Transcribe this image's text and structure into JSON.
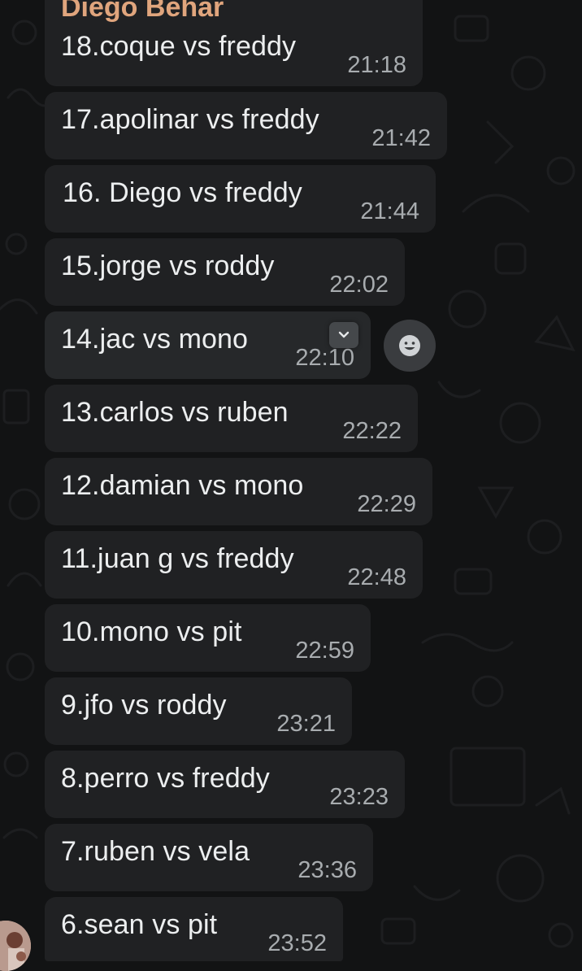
{
  "chat": {
    "sender_name": "Diego Behar",
    "messages": [
      {
        "text": "18.coque vs freddy",
        "time": "21:18"
      },
      {
        "text": "17.apolinar vs freddy",
        "time": "21:42"
      },
      {
        "text": "16. Diego vs freddy",
        "time": "21:44"
      },
      {
        "text": "15.jorge vs roddy",
        "time": "22:02"
      },
      {
        "text": "14.jac vs mono",
        "time": "22:10"
      },
      {
        "text": "13.carlos vs ruben",
        "time": "22:22"
      },
      {
        "text": "12.damian vs mono",
        "time": "22:29"
      },
      {
        "text": "11.juan g vs freddy",
        "time": "22:48"
      },
      {
        "text": "10.mono vs pit",
        "time": "22:59"
      },
      {
        "text": "9.jfo vs roddy",
        "time": "23:21"
      },
      {
        "text": "8.perro vs freddy",
        "time": "23:23"
      },
      {
        "text": "7.ruben vs vela",
        "time": "23:36"
      },
      {
        "text": "6.sean vs pit",
        "time": "23:52"
      }
    ]
  },
  "hover_actions": {
    "menu_icon": "chevron-down-icon",
    "react_icon": "smiley-icon"
  },
  "colors": {
    "background": "#121314",
    "bubble": "#202123",
    "text": "#eceeef",
    "timestamp": "#a8acaf",
    "sender_name": "#e0a57d"
  }
}
